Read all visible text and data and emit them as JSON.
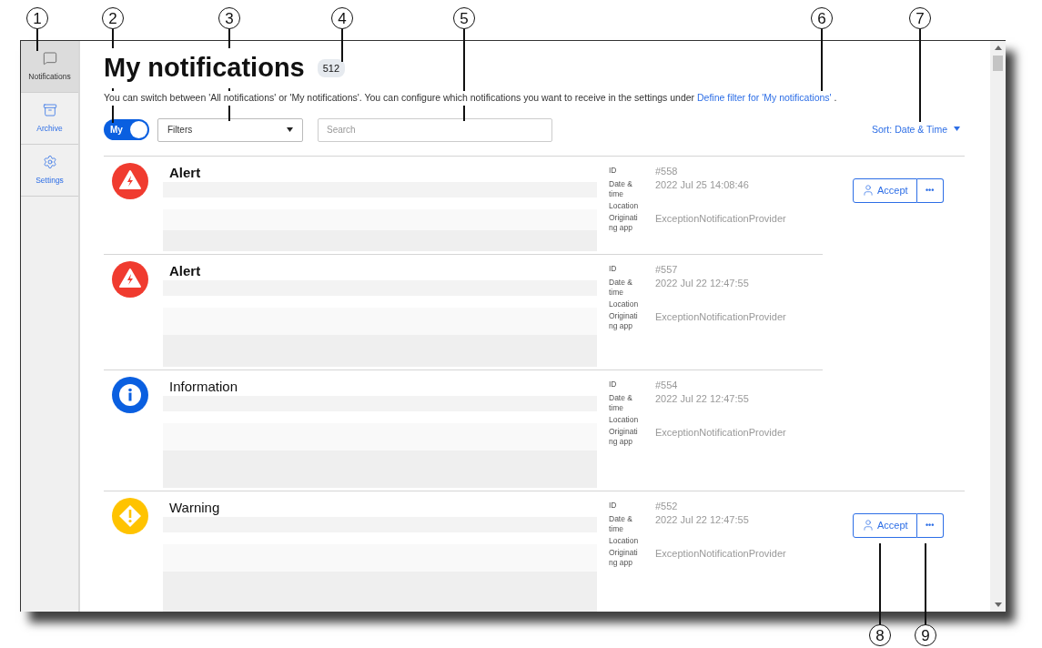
{
  "sidebar": {
    "items": [
      {
        "kind": "notifications",
        "label": "Notifications",
        "selected": true
      },
      {
        "kind": "archive",
        "label": "Archive",
        "selected": false
      },
      {
        "kind": "settings",
        "label": "Settings",
        "selected": false
      }
    ]
  },
  "header": {
    "title": "My notifications",
    "count": "512"
  },
  "description": {
    "text": "You can switch between 'All notifications' or 'My notifications'. You can configure which notifications you want to receive in the settings under",
    "link": "Define filter for 'My notifications'",
    "tail": "."
  },
  "toolbar": {
    "toggle": {
      "label": "My",
      "on": true
    },
    "filters": {
      "value": "Filters"
    },
    "search": {
      "placeholder": "Search"
    },
    "sort": {
      "label": "Sort:",
      "value": "Date & Time"
    }
  },
  "notifications": [
    {
      "kind": "alert",
      "title": "Alert",
      "unread": true,
      "details": [
        {
          "label": "ID",
          "value": "#558"
        },
        {
          "label": "Date & time",
          "value": "2022 Jul 25 14:08:46"
        },
        {
          "label": "Location"
        },
        {
          "label": "Originating app",
          "value": "ExceptionNotificationProvider"
        }
      ],
      "actions": {
        "accept": "Accept",
        "more": "•••"
      }
    },
    {
      "kind": "alert",
      "title": "Alert",
      "unread": true,
      "details": [
        {
          "label": "ID",
          "value": "#557"
        },
        {
          "label": "Date & time",
          "value": "2022 Jul 22 12:47:55"
        },
        {
          "label": "Location"
        },
        {
          "label": "Originating app",
          "value": "ExceptionNotificationProvider"
        }
      ]
    },
    {
      "kind": "info",
      "title": "Information",
      "unread": false,
      "details": [
        {
          "label": "ID",
          "value": "#554"
        },
        {
          "label": "Date & time",
          "value": "2022 Jul 22 12:47:55"
        },
        {
          "label": "Location"
        },
        {
          "label": "Originating app",
          "value": "ExceptionNotificationProvider"
        }
      ]
    },
    {
      "kind": "warning",
      "title": "Warning",
      "unread": false,
      "details": [
        {
          "label": "ID",
          "value": "#552"
        },
        {
          "label": "Date & time",
          "value": "2022 Jul 22 12:47:55"
        },
        {
          "label": "Location"
        },
        {
          "label": "Originating app",
          "value": "ExceptionNotificationProvider"
        }
      ],
      "actions": {
        "accept": "Accept",
        "more": "•••"
      }
    }
  ],
  "callouts": [
    {
      "label": "1"
    },
    {
      "label": "2"
    },
    {
      "label": "3"
    },
    {
      "label": "4"
    },
    {
      "label": "5"
    },
    {
      "label": "6"
    },
    {
      "label": "7"
    },
    {
      "label": "8"
    },
    {
      "label": "9"
    }
  ]
}
